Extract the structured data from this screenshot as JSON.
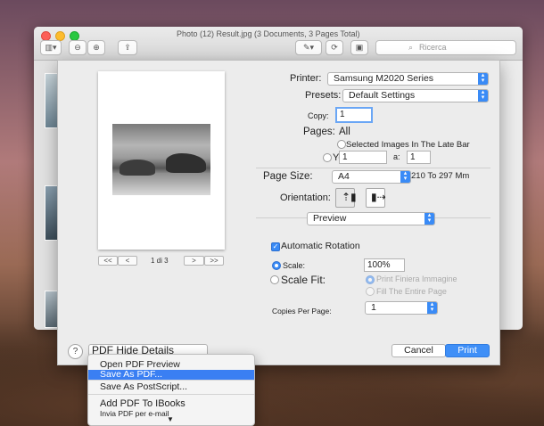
{
  "window": {
    "title": "Photo (12) Result.jpg (3 Documents, 3 Pages Total)",
    "search_placeholder": "Ricerca"
  },
  "preview": {
    "page_indicator": "1 di 3",
    "nav_first": "<<",
    "nav_prev": "<",
    "nav_next": ">",
    "nav_last": ">>"
  },
  "print": {
    "printer_label": "Printer:",
    "printer_value": "Samsung M2020 Series",
    "presets_label": "Presets:",
    "presets_value": "Default Settings",
    "copy_label": "Copy:",
    "copy_value": "1",
    "pages_label": "Pages:",
    "pages_value": "All",
    "selected_images_label": "Selected Images In The Late Bar",
    "yes_label": "Yes:",
    "range_from": "1",
    "range_to_label": "a:",
    "range_to": "1",
    "page_size_label": "Page Size:",
    "page_size_value": "A4",
    "page_size_dims": "210 To 297 Mm",
    "orientation_label": "Orientation:",
    "section_value": "Preview",
    "auto_rotation_label": "Automatic Rotation",
    "scale_label": "Scale:",
    "scale_value": "100%",
    "scale_fit_label": "Scale Fit:",
    "print_entire_image_label": "Print Finiera Immagine",
    "fill_entire_page_label": "Fill The Entire Page",
    "copies_per_page_label": "Copies Per Page:",
    "copies_per_page_value": "1",
    "help_label": "?",
    "pdf_button_label": "PDF Hide Details",
    "cancel_label": "Cancel",
    "print_label": "Print"
  },
  "pdf_menu": {
    "items": [
      "Open PDF Preview",
      "Save As PDF...",
      "Save As PostScript...",
      "Add PDF To IBooks",
      "Invia PDF per e-mail"
    ],
    "selected_index": 1
  },
  "colors": {
    "accent": "#3a8bf6",
    "selection": "#3a7ff3"
  }
}
